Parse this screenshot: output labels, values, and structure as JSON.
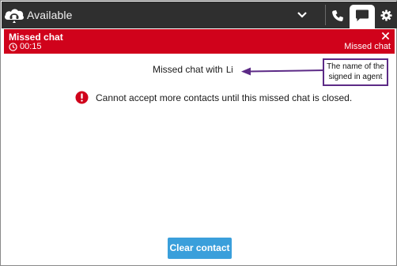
{
  "topbar": {
    "status": "Available",
    "icons": {
      "brand": "cloud-headset-icon",
      "status_dropdown": "chevron-down-icon",
      "phone": "phone-icon",
      "chat": "chat-bubble-icon",
      "settings": "gear-icon"
    }
  },
  "banner": {
    "title": "Missed chat",
    "timer": "00:15",
    "state": "Missed chat",
    "color": "#d0021b",
    "icons": {
      "timer": "clock-icon",
      "dismiss": "close-icon"
    }
  },
  "main": {
    "message_prefix": "Missed chat with",
    "agent_name": "Li",
    "warning": "Cannot accept more contacts until this missed chat is closed.",
    "warning_color": "#d0021b"
  },
  "callout": {
    "text": "The name of the signed in agent",
    "border_color": "#5c2a86"
  },
  "actions": {
    "clear_label": "Clear contact",
    "accent": "#3a9fdb"
  }
}
